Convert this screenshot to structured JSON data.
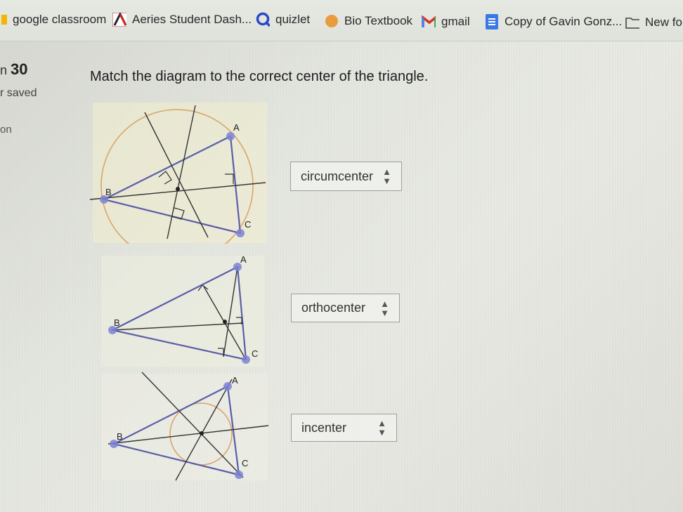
{
  "bookmarks": [
    {
      "label": "google classroom",
      "icon": "classroom-icon"
    },
    {
      "label": "Aeries Student Dash...",
      "icon": "aeries-icon"
    },
    {
      "label": "quizlet",
      "icon": "quizlet-icon"
    },
    {
      "label": "Bio Textbook",
      "icon": "circle-icon"
    },
    {
      "label": "gmail",
      "icon": "gmail-icon"
    },
    {
      "label": "Copy of Gavin Gonz...",
      "icon": "docs-icon"
    },
    {
      "label": "New fol",
      "icon": "folder-icon"
    }
  ],
  "question": {
    "number": "30",
    "saved_text": "saved",
    "side_text": "on",
    "prompt": "Match the diagram to the correct center of the triangle."
  },
  "diagrams": {
    "d1": {
      "A": "A",
      "B": "B",
      "C": "C"
    },
    "d2": {
      "A": "A",
      "B": "B",
      "C": "C"
    },
    "d3": {
      "A": "A",
      "B": "B",
      "C": "C"
    }
  },
  "answers": [
    {
      "value": "circumcenter"
    },
    {
      "value": "orthocenter"
    },
    {
      "value": "incenter"
    }
  ],
  "colors": {
    "triangle": "#5a5ea8",
    "circle": "#d9a56a",
    "vertex": "#7d83d6"
  }
}
